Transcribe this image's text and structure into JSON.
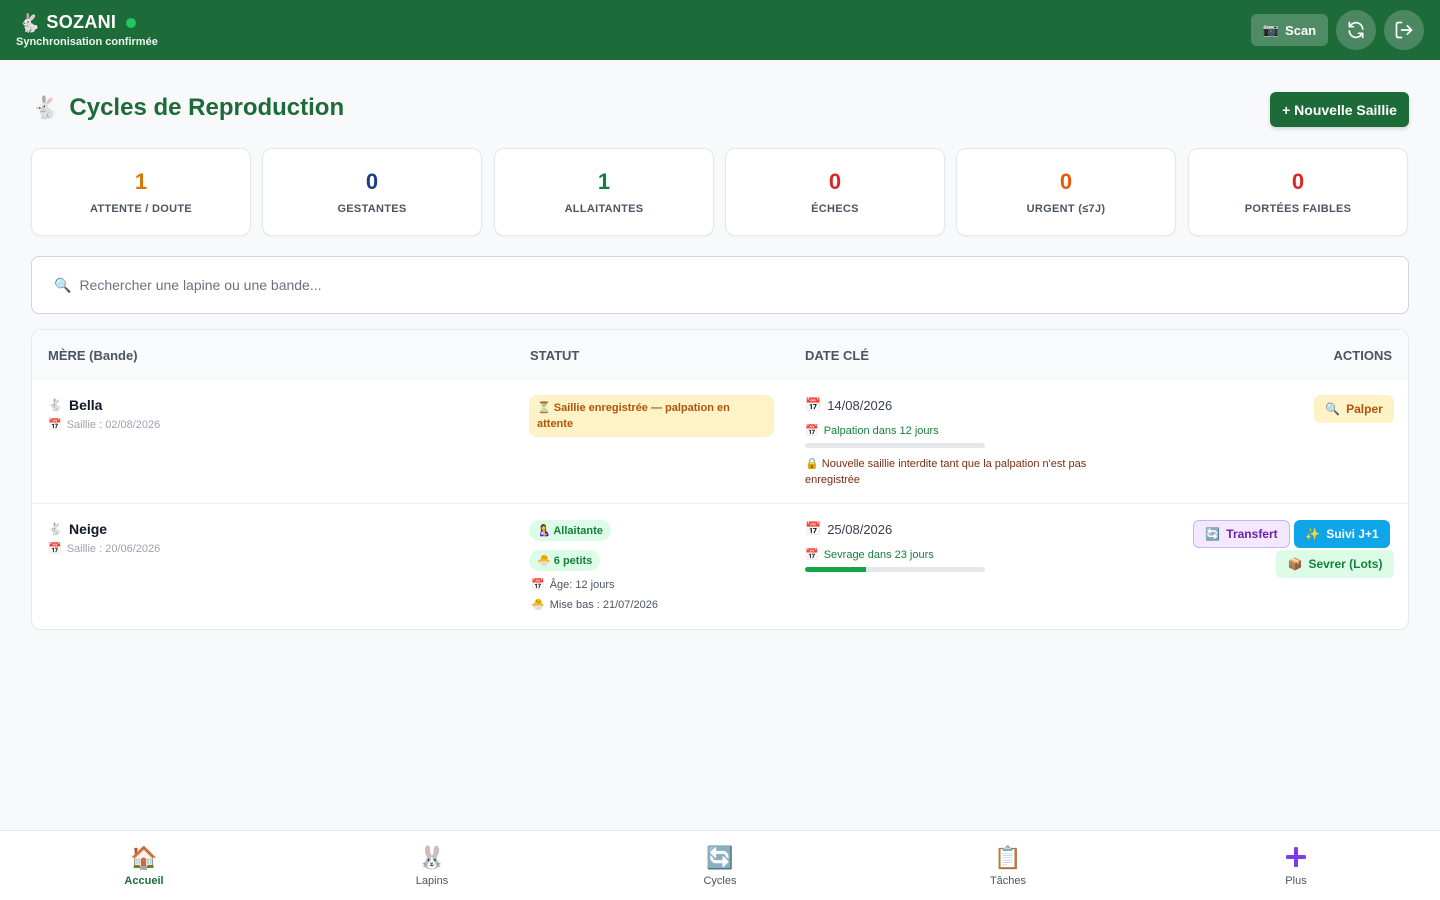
{
  "header": {
    "app_name": "SOZANI",
    "sync_status": "Synchronisation confirmée",
    "scan_label": "Scan",
    "status_color": "#22c55e"
  },
  "page": {
    "title": "Cycles de Reproduction",
    "new_button": "+ Nouvelle Saillie"
  },
  "stats": [
    {
      "value": "1",
      "label": "ATTENTE / DOUTE",
      "color": "#d97706"
    },
    {
      "value": "0",
      "label": "GESTANTES",
      "color": "#1e3a8a"
    },
    {
      "value": "1",
      "label": "ALLAITANTES",
      "color": "#15803d"
    },
    {
      "value": "0",
      "label": "ÉCHECS",
      "color": "#dc2626"
    },
    {
      "value": "0",
      "label": "URGENT (≤7J)",
      "color": "#ea580c"
    },
    {
      "value": "0",
      "label": "PORTÉES FAIBLES",
      "color": "#dc2626"
    }
  ],
  "search": {
    "placeholder": "Rechercher une lapine ou une bande..."
  },
  "table": {
    "headers": {
      "mother": "MÈRE (Bande)",
      "status": "STATUT",
      "key_date": "DATE CLÉ",
      "actions": "ACTIONS"
    },
    "rows": [
      {
        "name": "Bella",
        "saillie": "Saillie : 02/08/2026",
        "status": "Saillie enregistrée — palpation en attente",
        "date": "14/08/2026",
        "countdown": "Palpation dans 12 jours",
        "progress": 0,
        "warning": "Nouvelle saillie interdite tant que la palpation n'est pas enregistrée",
        "actions": {
          "palper": "Palper"
        }
      },
      {
        "name": "Neige",
        "saillie": "Saillie : 20/06/2026",
        "status": "Allaitante",
        "litter": "6 petits",
        "age": "Âge: 12 jours",
        "birth": "Mise bas : 21/07/2026",
        "date": "25/08/2026",
        "countdown": "Sevrage dans 23 jours",
        "progress": 0.34,
        "actions": {
          "transfert": "Transfert",
          "suivi": "Suivi J+1",
          "sevrer": "Sevrer (Lots)"
        }
      }
    ]
  },
  "nav": [
    {
      "label": "Accueil",
      "icon": "house-icon"
    },
    {
      "label": "Lapins",
      "icon": "rabbit-icon"
    },
    {
      "label": "Cycles",
      "icon": "cycle-icon"
    },
    {
      "label": "Tâches",
      "icon": "clipboard-icon"
    },
    {
      "label": "Plus",
      "icon": "plus-icon"
    }
  ],
  "nav_active": "Accueil"
}
